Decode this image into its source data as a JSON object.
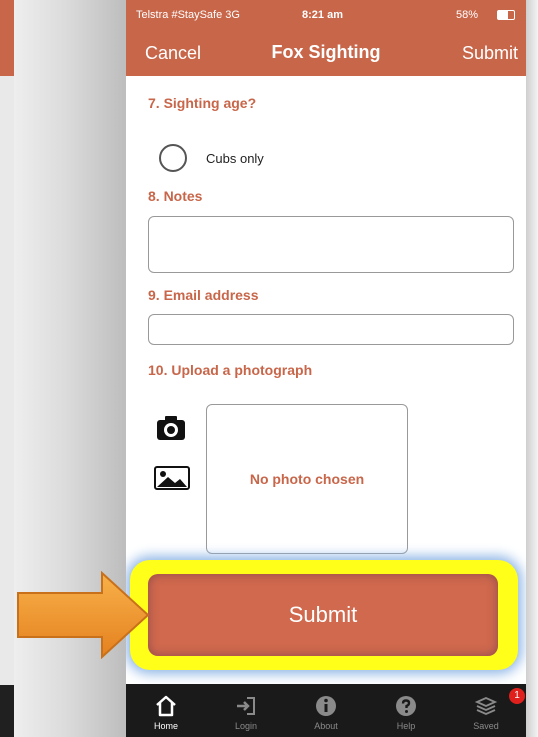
{
  "status_bar": {
    "carrier": "Telstra #StaySafe  3G",
    "time": "8:21 am",
    "battery": "58%"
  },
  "nav": {
    "cancel_label": "Cancel",
    "title": "Fox Sighting",
    "submit_label": "Submit"
  },
  "form": {
    "q7": {
      "label": "7. Sighting age?",
      "option": "Cubs only"
    },
    "q8": {
      "label": "8. Notes",
      "value": ""
    },
    "q9": {
      "label": "9. Email address",
      "value": ""
    },
    "q10": {
      "label": "10. Upload a photograph",
      "photo_status": "No photo chosen"
    },
    "submit_button_label": "Submit"
  },
  "tab_bar": {
    "items": [
      {
        "label": "Home",
        "icon": "home-icon"
      },
      {
        "label": "Login",
        "icon": "login-icon"
      },
      {
        "label": "About",
        "icon": "info-icon"
      },
      {
        "label": "Help",
        "icon": "help-icon"
      },
      {
        "label": "Saved",
        "icon": "saved-stack-icon"
      }
    ],
    "saved_badge": "1"
  },
  "colors": {
    "accent": "#c8664a",
    "highlight": "#ffff1a",
    "arrow": "#f0962a",
    "tab_bar": "#1a1a1a"
  }
}
